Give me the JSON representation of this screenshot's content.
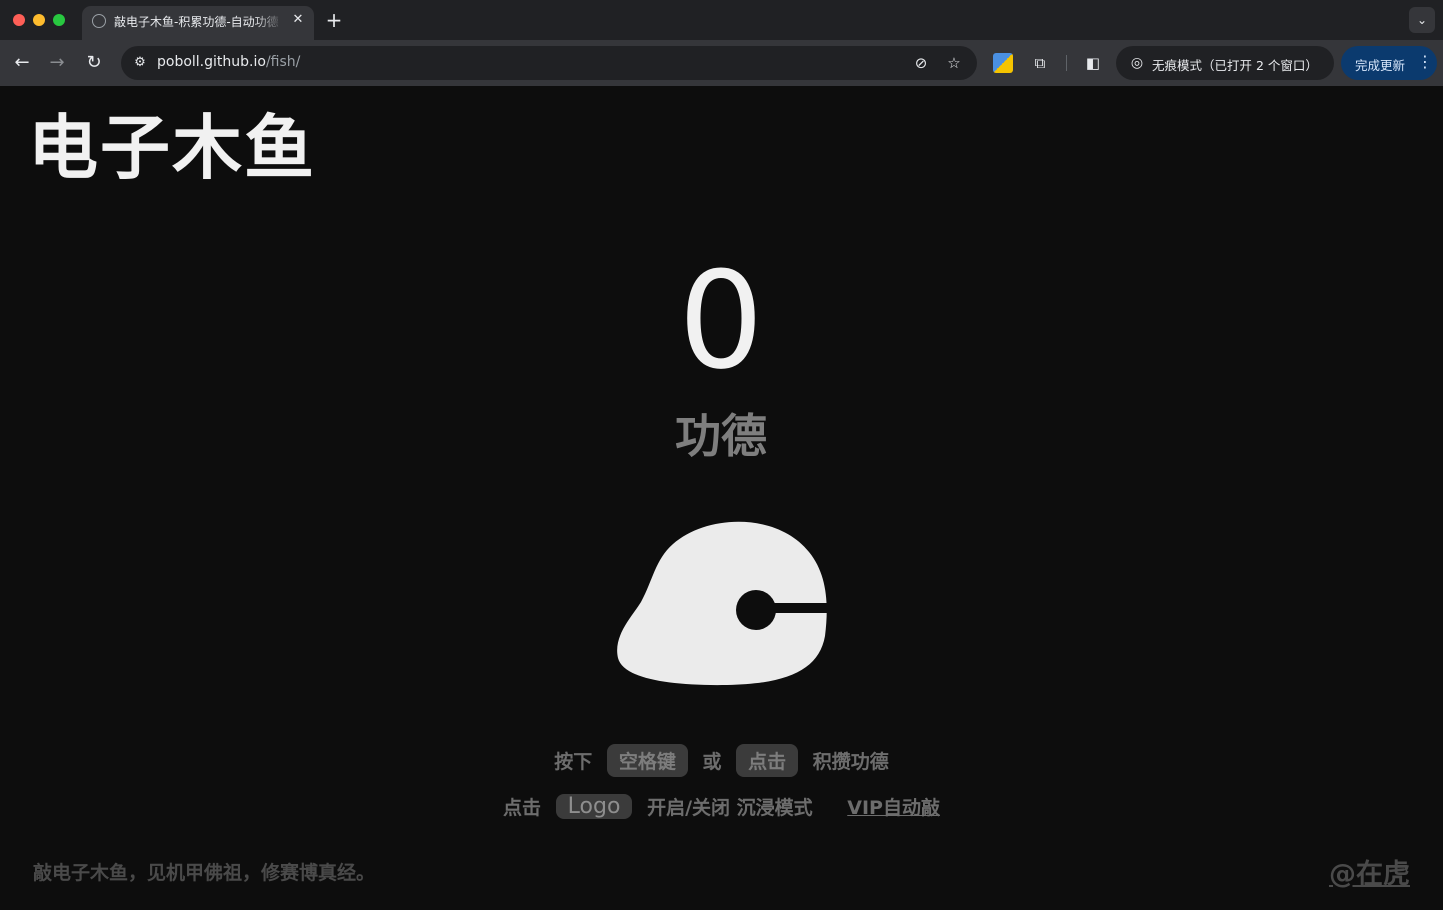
{
  "browser": {
    "tab_title": "敲电子木鱼-积累功德-自动功德",
    "url_host": "poboll.github.io",
    "url_path": "/fish/",
    "incognito_label": "无痕模式（已打开 2 个窗口）",
    "update_label": "完成更新",
    "icons": {
      "back": "←",
      "forward": "→",
      "reload": "↻",
      "site_info": "⚙",
      "eye_off": "⊘",
      "star": "☆",
      "puzzle": "⧉",
      "side_panel": "◧",
      "incognito": "◎",
      "more": "⋮",
      "close": "✕",
      "plus": "+",
      "chevron": "⌄"
    }
  },
  "page": {
    "logo": "电子木鱼",
    "counter": "0",
    "merit_label": "功德",
    "hint1": {
      "press": "按下",
      "key_space": "空格键",
      "or": "或",
      "key_click": "点击",
      "accumulate": "积攒功德"
    },
    "hint2": {
      "click": "点击",
      "key_logo": "Logo",
      "toggle": "开启/关闭 沉浸模式",
      "vip": "VIP自动敲"
    },
    "footer_left": "敲电子木鱼，见机甲佛祖，修赛博真经。",
    "footer_right": "@在虎"
  },
  "colors": {
    "background": "#0d0d0d",
    "fish_fill": "#ebebeb",
    "counter_text": "#f1f1f1",
    "muted_text": "#6d6d6d",
    "key_bg": "#3b3b3b",
    "update_button": "#0b3a6e"
  }
}
